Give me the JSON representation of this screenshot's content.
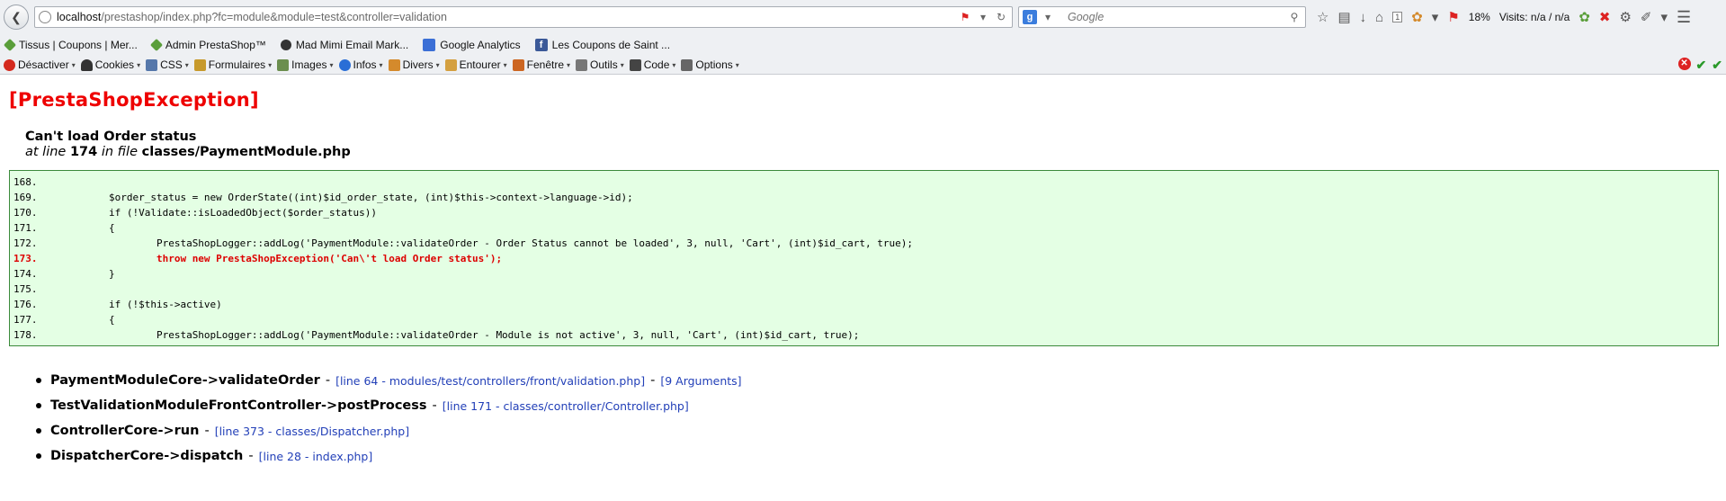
{
  "browser": {
    "url_host": "localhost",
    "url_path": "/prestashop/index.php?fc=module&module=test&controller=validation",
    "search_placeholder": "Google",
    "download_badge": "1",
    "percent": "18%",
    "visits": "Visits: n/a / n/a"
  },
  "bookmarks": [
    {
      "label": "Tissus | Coupons | Mer...",
      "icon": "leaf-icon"
    },
    {
      "label": "Admin PrestaShop™",
      "icon": "leaf-icon"
    },
    {
      "label": "Mad Mimi Email Mark...",
      "icon": "mimi-icon"
    },
    {
      "label": "Google Analytics",
      "icon": "analytics-icon"
    },
    {
      "label": "Les Coupons de Saint ...",
      "icon": "facebook-icon"
    }
  ],
  "devtoolbar": [
    {
      "label": "Désactiver",
      "color": "#d42a1e"
    },
    {
      "label": "Cookies",
      "color": "#333333"
    },
    {
      "label": "CSS",
      "color": "#5577aa"
    },
    {
      "label": "Formulaires",
      "color": "#c79a2c"
    },
    {
      "label": "Images",
      "color": "#6b8e4e"
    },
    {
      "label": "Infos",
      "color": "#2a6ed6"
    },
    {
      "label": "Divers",
      "color": "#d48a2c"
    },
    {
      "label": "Entourer",
      "color": "#d4a040"
    },
    {
      "label": "Fenêtre",
      "color": "#cc6622"
    },
    {
      "label": "Outils",
      "color": "#777777"
    },
    {
      "label": "Code",
      "color": "#444444"
    },
    {
      "label": "Options",
      "color": "#666666"
    }
  ],
  "exception": {
    "title": "[PrestaShopException]",
    "message": "Can't load Order status",
    "at_line_prefix": "at line",
    "line": "174",
    "in_file_prefix": "in file",
    "file": "classes/PaymentModule.php"
  },
  "code_lines": [
    {
      "num": "168.",
      "text": "",
      "highlight": false
    },
    {
      "num": "169.",
      "text": "\t\t$order_status = new OrderState((int)$id_order_state, (int)$this->context->language->id);",
      "highlight": false
    },
    {
      "num": "170.",
      "text": "\t\tif (!Validate::isLoadedObject($order_status))",
      "highlight": false
    },
    {
      "num": "171.",
      "text": "\t\t{",
      "highlight": false
    },
    {
      "num": "172.",
      "text": "\t\t\tPrestaShopLogger::addLog('PaymentModule::validateOrder - Order Status cannot be loaded', 3, null, 'Cart', (int)$id_cart, true);",
      "highlight": false
    },
    {
      "num": "173.",
      "text": "\t\t\tthrow new PrestaShopException('Can\\'t load Order status');",
      "highlight": true
    },
    {
      "num": "174.",
      "text": "\t\t}",
      "highlight": false
    },
    {
      "num": "175.",
      "text": "",
      "highlight": false
    },
    {
      "num": "176.",
      "text": "\t\tif (!$this->active)",
      "highlight": false
    },
    {
      "num": "177.",
      "text": "\t\t{",
      "highlight": false
    },
    {
      "num": "178.",
      "text": "\t\t\tPrestaShopLogger::addLog('PaymentModule::validateOrder - Module is not active', 3, null, 'Cart', (int)$id_cart, true);",
      "highlight": false
    }
  ],
  "trace": [
    {
      "fn": "PaymentModuleCore->validateOrder",
      "link": "[line 64 - modules/test/controllers/front/validation.php]",
      "extra": "[9 Arguments]"
    },
    {
      "fn": "TestValidationModuleFrontController->postProcess",
      "link": "[line 171 - classes/controller/Controller.php]",
      "extra": ""
    },
    {
      "fn": "ControllerCore->run",
      "link": "[line 373 - classes/Dispatcher.php]",
      "extra": ""
    },
    {
      "fn": "DispatcherCore->dispatch",
      "link": "[line 28 - index.php]",
      "extra": ""
    }
  ]
}
